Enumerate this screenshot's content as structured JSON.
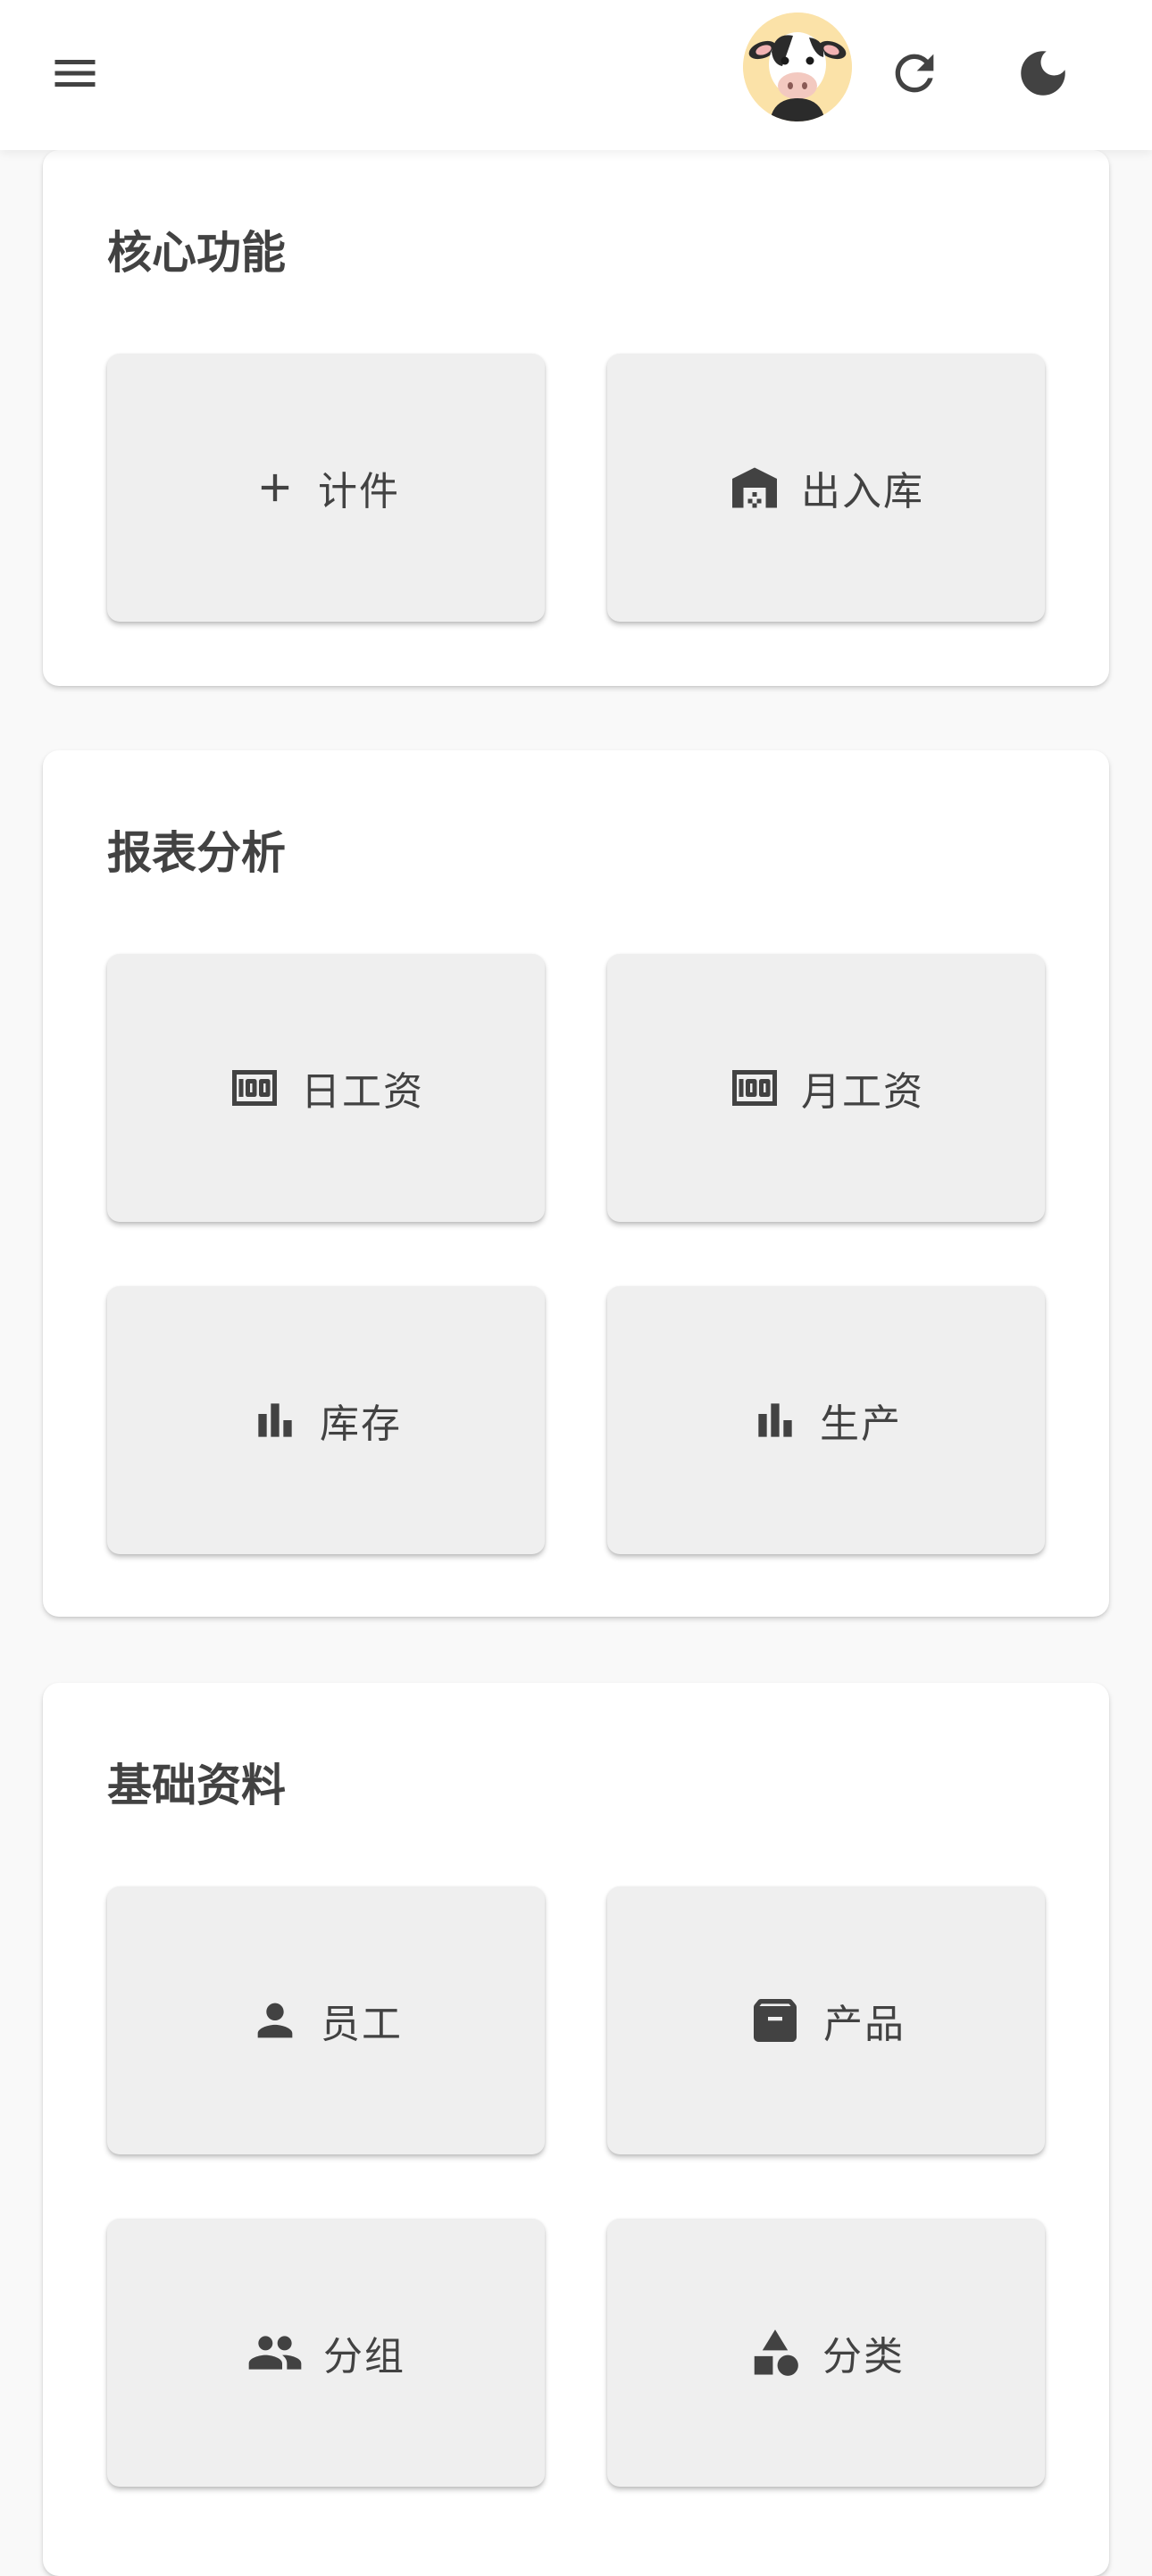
{
  "appbar": {
    "menu_icon": "menu-icon",
    "avatar_icon": "cow-avatar",
    "refresh_icon": "refresh-icon",
    "theme_icon": "dark-mode-icon"
  },
  "sections": {
    "core": {
      "title": "核心功能",
      "tiles": [
        {
          "label": "计件",
          "icon": "plus-icon"
        },
        {
          "label": "出入库",
          "icon": "warehouse-icon"
        }
      ]
    },
    "reports": {
      "title": "报表分析",
      "tiles": [
        {
          "label": "日工资",
          "icon": "money-icon"
        },
        {
          "label": "月工资",
          "icon": "money-icon"
        },
        {
          "label": "库存",
          "icon": "bar-chart-icon"
        },
        {
          "label": "生产",
          "icon": "bar-chart-icon"
        }
      ]
    },
    "basic": {
      "title": "基础资料",
      "tiles": [
        {
          "label": "员工",
          "icon": "person-icon"
        },
        {
          "label": "产品",
          "icon": "archive-icon"
        },
        {
          "label": "分组",
          "icon": "group-icon"
        },
        {
          "label": "分类",
          "icon": "category-icon"
        }
      ]
    }
  },
  "colors": {
    "icon": "#424242",
    "tile_bg": "#efefef",
    "card_bg": "#ffffff",
    "page_bg": "#f9f9f9"
  }
}
